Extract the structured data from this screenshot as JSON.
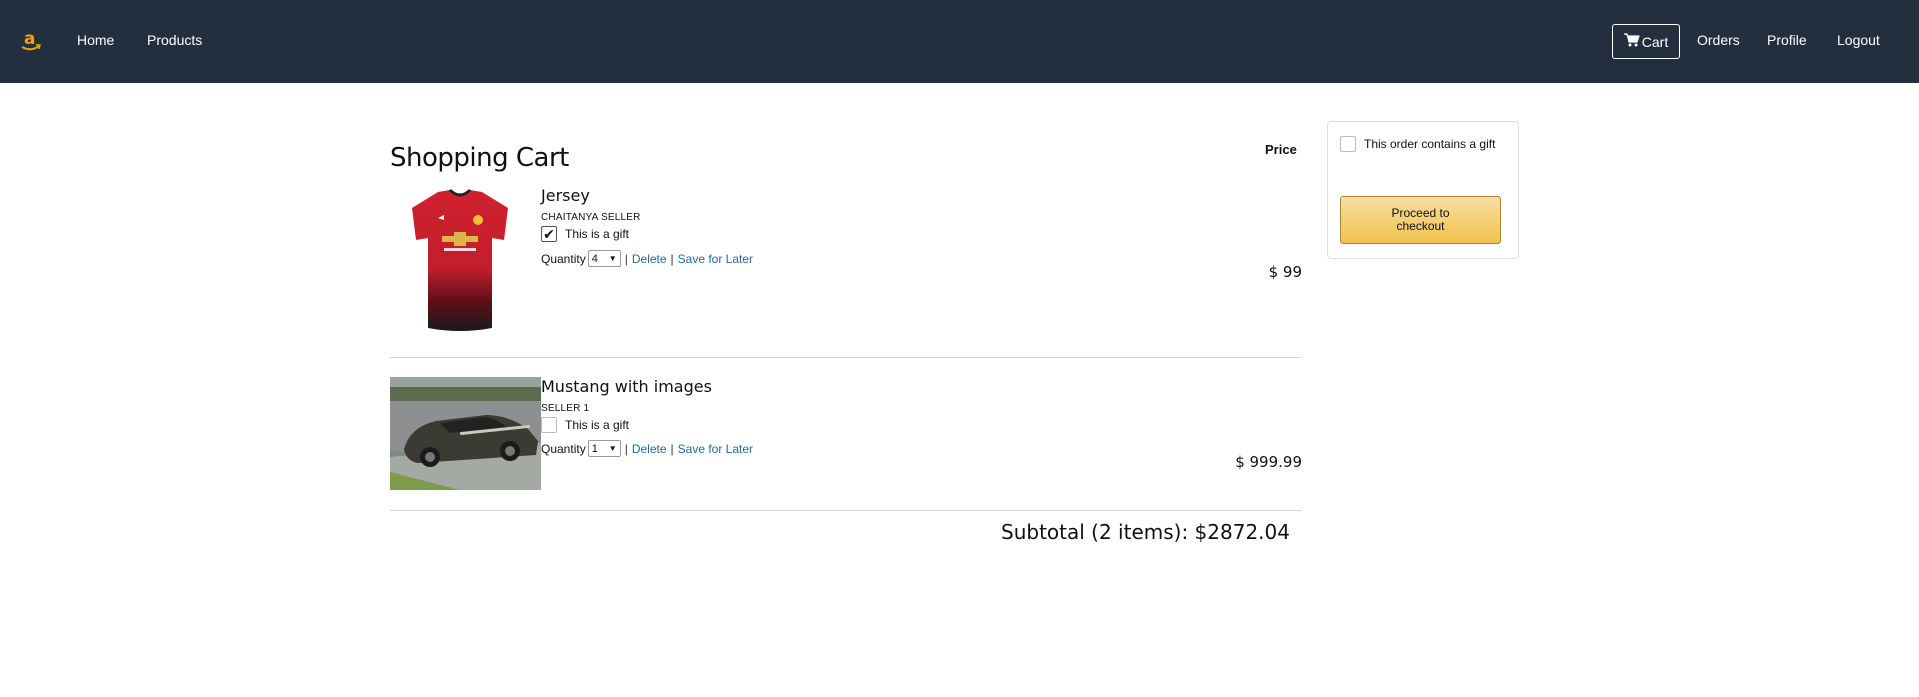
{
  "nav": {
    "logo_letter": "a",
    "home": "Home",
    "products": "Products",
    "cart": "Cart",
    "orders": "Orders",
    "profile": "Profile",
    "logout": "Logout"
  },
  "cart": {
    "title": "Shopping Cart",
    "price_header": "Price",
    "items": [
      {
        "name": "Jersey",
        "seller": "CHAITANYA SELLER",
        "gift_label": "This is a gift",
        "gift_checked": true,
        "quantity_label": "Quantity",
        "quantity": "4",
        "delete_label": "Delete",
        "save_label": "Save for Later",
        "price": "$ 99",
        "image": "red-jersey-image"
      },
      {
        "name": "Mustang with images",
        "seller": "SELLER 1",
        "gift_label": "This is a gift",
        "gift_checked": false,
        "quantity_label": "Quantity",
        "quantity": "1",
        "delete_label": "Delete",
        "save_label": "Save for Later",
        "price": "$ 999.99",
        "image": "mustang-car-image"
      }
    ],
    "separator": "|",
    "subtotal": "Subtotal (2 items): $2872.04"
  },
  "checkout": {
    "gift_label": "This order contains a gift",
    "gift_checked": false,
    "button_label": "Proceed to checkout"
  },
  "colors": {
    "navbar": "#232f3e",
    "logo": "#f0a500",
    "link": "#1f6aa8",
    "button": "#f0c14b"
  }
}
